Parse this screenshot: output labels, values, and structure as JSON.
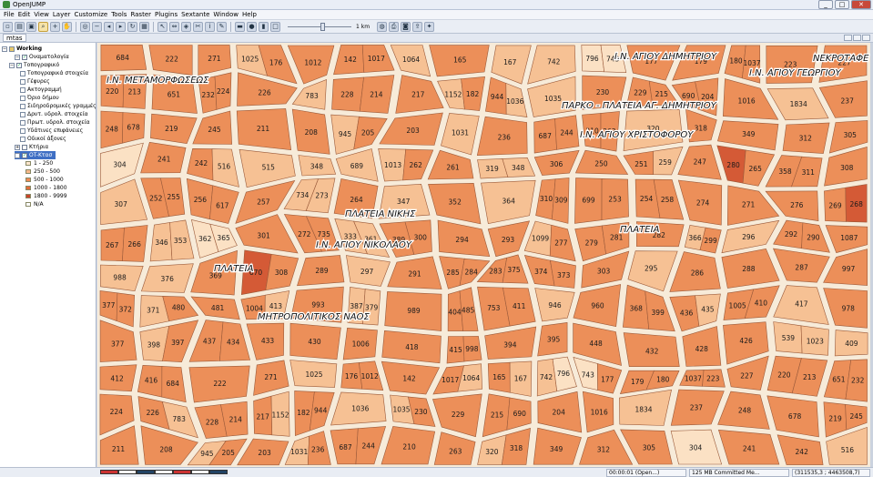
{
  "window": {
    "title": "OpenJUMP",
    "minimize": "_",
    "maximize": "□",
    "close": "✕"
  },
  "menu": [
    "File",
    "Edit",
    "View",
    "Layer",
    "Customize",
    "Tools",
    "Raster",
    "Plugins",
    "Sextante",
    "Window",
    "Help"
  ],
  "toolbar": {
    "icons": [
      "new-project-icon",
      "open-icon",
      "save-icon",
      "zoom-to-selection-icon",
      "zoom-in-icon",
      "pan-icon",
      "zoom-full-icon",
      "zoom-out-icon",
      "zoom-previous-icon",
      "zoom-next-icon",
      "refresh-icon",
      "grid-icon",
      "select-icon",
      "measure-icon",
      "layer-icon",
      "cut-icon",
      "info-icon",
      "edit-icon",
      "draw-icon",
      "color-icon",
      "fill-icon",
      "frame-icon",
      "globe-icon",
      "print-icon",
      "camera-icon",
      "export-icon",
      "compass-icon"
    ],
    "scale_label": "1 km"
  },
  "document": {
    "tab_label": "mtas"
  },
  "sidebar": {
    "category": "Working",
    "layers": [
      {
        "label": "Οναματολογία",
        "checked": true,
        "indent": 2
      },
      {
        "label": "Τοπογραφικό",
        "checked": true,
        "indent": 1
      },
      {
        "label": "Τοπογραφικά στοιχεία",
        "indent": 3
      },
      {
        "label": "Γέφυρες",
        "indent": 3
      },
      {
        "label": "Ακτογραμμή",
        "indent": 3
      },
      {
        "label": "Όριο δήμου",
        "indent": 3
      },
      {
        "label": "Σιδηροδρομικές γραμμές",
        "indent": 3
      },
      {
        "label": "Δρυτ. υδρολ. στοιχεία",
        "indent": 3
      },
      {
        "label": "Πρωτ. υδρολ. στοιχεία",
        "indent": 3
      },
      {
        "label": "Υδάτινες επιφάνειες",
        "indent": 3
      },
      {
        "label": "Οδικοί άξονες",
        "checked": true,
        "indent": 3
      },
      {
        "label": "Κτήρια",
        "indent": 2
      },
      {
        "label": "OT-Κτασ",
        "checked": true,
        "indent": 2,
        "selected": true
      }
    ],
    "legend": [
      {
        "label": "1 - 250",
        "color": "#fde6cd"
      },
      {
        "label": "250 - 500",
        "color": "#f7b98b"
      },
      {
        "label": "500 - 1000",
        "color": "#ee8a55"
      },
      {
        "label": "1000 - 1800",
        "color": "#e06c3b"
      },
      {
        "label": "1800 - 9999",
        "color": "#c9442a"
      },
      {
        "label": "N/A",
        "color": "#ffffff"
      }
    ]
  },
  "map": {
    "labels": [
      {
        "text": "Ι.Ν. ΜΕΤΑΜΟΡΦΩΣΕΩΣ"
      },
      {
        "text": "Ι.Ν. ΑΓΙΟΥ ΔΗΜΗΤΡΙΟΥ"
      },
      {
        "text": "Ι.Ν. ΑΓΙΟΥ ΓΕΩΡΓΙΟΥ"
      },
      {
        "text": "ΝΕΚΡΟΤΑΦΕ"
      },
      {
        "text": "ΠΑΡΚΟ - ΠΛΑΤΕΙΑ ΑΓ. ΔΗΜΗΤΡΙΟΥ"
      },
      {
        "text": "Ι.Ν. ΑΓΙΟΥ ΧΡΙΣΤΟΦΟΡΟΥ"
      },
      {
        "text": "ΠΛΑΤΕΙΑ ΝΙΚΗΣ"
      },
      {
        "text": "Ι.Ν. ΑΓΙΟΥ ΝΙΚΟΛΑΟΥ"
      },
      {
        "text": "ΠΛΑΤΕΙΑ"
      },
      {
        "text": "ΠΛΑΤΕΙΑ"
      },
      {
        "text": "ΜΗΤΡΟΠΟΛΙΤΙΚΟΣ ΝΑΟΣ"
      }
    ],
    "blocks": [
      {
        "id": "684",
        "t": 2
      },
      {
        "id": "222",
        "t": 2
      },
      {
        "id": "271",
        "t": 2
      },
      {
        "id": "1025",
        "t": 1
      },
      {
        "id": "176",
        "t": 2
      },
      {
        "id": "1012",
        "t": 2
      },
      {
        "id": "142",
        "t": 2
      },
      {
        "id": "1017",
        "t": 2
      },
      {
        "id": "1064",
        "t": 1
      },
      {
        "id": "165",
        "t": 2
      },
      {
        "id": "167",
        "t": 1
      },
      {
        "id": "742",
        "t": 1
      },
      {
        "id": "796",
        "t": 0
      },
      {
        "id": "743",
        "t": 0
      },
      {
        "id": "177",
        "t": 2
      },
      {
        "id": "179",
        "t": 2
      },
      {
        "id": "180",
        "t": 2
      },
      {
        "id": "1037",
        "t": 2
      },
      {
        "id": "223",
        "t": 2
      },
      {
        "id": "227",
        "t": 2
      },
      {
        "id": "220",
        "t": 2
      },
      {
        "id": "213",
        "t": 2
      },
      {
        "id": "651",
        "t": 2
      },
      {
        "id": "232",
        "t": 2
      },
      {
        "id": "224",
        "t": 2
      },
      {
        "id": "226",
        "t": 2
      },
      {
        "id": "783",
        "t": 1
      },
      {
        "id": "228",
        "t": 2
      },
      {
        "id": "214",
        "t": 2
      },
      {
        "id": "217",
        "t": 2
      },
      {
        "id": "1152",
        "t": 1
      },
      {
        "id": "182",
        "t": 2
      },
      {
        "id": "944",
        "t": 2
      },
      {
        "id": "1036",
        "t": 1
      },
      {
        "id": "1035",
        "t": 1
      },
      {
        "id": "230",
        "t": 2
      },
      {
        "id": "229",
        "t": 2
      },
      {
        "id": "215",
        "t": 2
      },
      {
        "id": "690",
        "t": 2
      },
      {
        "id": "204",
        "t": 2
      },
      {
        "id": "1016",
        "t": 2
      },
      {
        "id": "1834",
        "t": 1
      },
      {
        "id": "237",
        "t": 2
      },
      {
        "id": "248",
        "t": 2
      },
      {
        "id": "678",
        "t": 2
      },
      {
        "id": "219",
        "t": 2
      },
      {
        "id": "245",
        "t": 2
      },
      {
        "id": "211",
        "t": 2
      },
      {
        "id": "208",
        "t": 2
      },
      {
        "id": "945",
        "t": 1
      },
      {
        "id": "205",
        "t": 2
      },
      {
        "id": "203",
        "t": 2
      },
      {
        "id": "1031",
        "t": 1
      },
      {
        "id": "236",
        "t": 2
      },
      {
        "id": "687",
        "t": 2
      },
      {
        "id": "244",
        "t": 2
      },
      {
        "id": "210",
        "t": 2
      },
      {
        "id": "263",
        "t": 2
      },
      {
        "id": "320",
        "t": 1
      },
      {
        "id": "318",
        "t": 2
      },
      {
        "id": "349",
        "t": 2
      },
      {
        "id": "312",
        "t": 2
      },
      {
        "id": "305",
        "t": 2
      },
      {
        "id": "304",
        "t": 0
      },
      {
        "id": "241",
        "t": 2
      },
      {
        "id": "242",
        "t": 2
      },
      {
        "id": "516",
        "t": 1
      },
      {
        "id": "515",
        "t": 1
      },
      {
        "id": "348",
        "t": 1
      },
      {
        "id": "689",
        "t": 1
      },
      {
        "id": "1013",
        "t": 1
      },
      {
        "id": "262",
        "t": 2
      },
      {
        "id": "261",
        "t": 2
      },
      {
        "id": "319",
        "t": 1
      },
      {
        "id": "348",
        "t": 1
      },
      {
        "id": "306",
        "t": 2
      },
      {
        "id": "250",
        "t": 2
      },
      {
        "id": "251",
        "t": 2
      },
      {
        "id": "259",
        "t": 1
      },
      {
        "id": "247",
        "t": 2
      },
      {
        "id": "280",
        "t": 3
      },
      {
        "id": "265",
        "t": 2
      },
      {
        "id": "358",
        "t": 2
      },
      {
        "id": "311",
        "t": 2
      },
      {
        "id": "308",
        "t": 2
      },
      {
        "id": "307",
        "t": 1
      },
      {
        "id": "252",
        "t": 2
      },
      {
        "id": "255",
        "t": 2
      },
      {
        "id": "256",
        "t": 2
      },
      {
        "id": "617",
        "t": 2
      },
      {
        "id": "257",
        "t": 2
      },
      {
        "id": "734",
        "t": 1
      },
      {
        "id": "273",
        "t": 1
      },
      {
        "id": "264",
        "t": 2
      },
      {
        "id": "347",
        "t": 1
      },
      {
        "id": "352",
        "t": 2
      },
      {
        "id": "364",
        "t": 1
      },
      {
        "id": "310",
        "t": 2
      },
      {
        "id": "309",
        "t": 2
      },
      {
        "id": "699",
        "t": 2
      },
      {
        "id": "253",
        "t": 2
      },
      {
        "id": "254",
        "t": 2
      },
      {
        "id": "258",
        "t": 2
      },
      {
        "id": "274",
        "t": 2
      },
      {
        "id": "271",
        "t": 2
      },
      {
        "id": "276",
        "t": 2
      },
      {
        "id": "269",
        "t": 2
      },
      {
        "id": "268",
        "t": 3
      },
      {
        "id": "267",
        "t": 2
      },
      {
        "id": "266",
        "t": 2
      },
      {
        "id": "346",
        "t": 1
      },
      {
        "id": "353",
        "t": 1
      },
      {
        "id": "362",
        "t": 0
      },
      {
        "id": "365",
        "t": 0
      },
      {
        "id": "301",
        "t": 2
      },
      {
        "id": "272",
        "t": 2
      },
      {
        "id": "735",
        "t": 2
      },
      {
        "id": "333",
        "t": 1
      },
      {
        "id": "361",
        "t": 1
      },
      {
        "id": "389",
        "t": 2
      },
      {
        "id": "300",
        "t": 2
      },
      {
        "id": "294",
        "t": 2
      },
      {
        "id": "293",
        "t": 2
      },
      {
        "id": "1099",
        "t": 1
      },
      {
        "id": "277",
        "t": 2
      },
      {
        "id": "279",
        "t": 2
      },
      {
        "id": "281",
        "t": 2
      },
      {
        "id": "282",
        "t": 2
      },
      {
        "id": "366",
        "t": 1
      },
      {
        "id": "299",
        "t": 2
      },
      {
        "id": "296",
        "t": 1
      },
      {
        "id": "292",
        "t": 2
      },
      {
        "id": "290",
        "t": 2
      },
      {
        "id": "1087",
        "t": 2
      },
      {
        "id": "988",
        "t": 1
      },
      {
        "id": "376",
        "t": 1
      },
      {
        "id": "369",
        "t": 2
      },
      {
        "id": "670",
        "t": 3
      },
      {
        "id": "308",
        "t": 2
      },
      {
        "id": "289",
        "t": 2
      },
      {
        "id": "297",
        "t": 1
      },
      {
        "id": "291",
        "t": 2
      },
      {
        "id": "285",
        "t": 2
      },
      {
        "id": "284",
        "t": 2
      },
      {
        "id": "283",
        "t": 2
      },
      {
        "id": "375",
        "t": 2
      },
      {
        "id": "374",
        "t": 2
      },
      {
        "id": "373",
        "t": 2
      },
      {
        "id": "303",
        "t": 2
      },
      {
        "id": "295",
        "t": 1
      },
      {
        "id": "286",
        "t": 2
      },
      {
        "id": "288",
        "t": 2
      },
      {
        "id": "287",
        "t": 2
      },
      {
        "id": "997",
        "t": 2
      },
      {
        "id": "377",
        "t": 2
      },
      {
        "id": "372",
        "t": 2
      },
      {
        "id": "371",
        "t": 1
      },
      {
        "id": "480",
        "t": 2
      },
      {
        "id": "481",
        "t": 2
      },
      {
        "id": "1004",
        "t": 2
      },
      {
        "id": "413",
        "t": 1
      },
      {
        "id": "993",
        "t": 2
      },
      {
        "id": "387",
        "t": 1
      },
      {
        "id": "379",
        "t": 1
      },
      {
        "id": "989",
        "t": 2
      },
      {
        "id": "404",
        "t": 2
      },
      {
        "id": "485",
        "t": 2
      },
      {
        "id": "753",
        "t": 2
      },
      {
        "id": "411",
        "t": 2
      },
      {
        "id": "946",
        "t": 1
      },
      {
        "id": "960",
        "t": 2
      },
      {
        "id": "368",
        "t": 2
      },
      {
        "id": "399",
        "t": 2
      },
      {
        "id": "436",
        "t": 2
      },
      {
        "id": "435",
        "t": 1
      },
      {
        "id": "1005",
        "t": 2
      },
      {
        "id": "410",
        "t": 2
      },
      {
        "id": "417",
        "t": 1
      },
      {
        "id": "978",
        "t": 2
      },
      {
        "id": "377",
        "t": 2
      },
      {
        "id": "398",
        "t": 1
      },
      {
        "id": "397",
        "t": 2
      },
      {
        "id": "437",
        "t": 2
      },
      {
        "id": "434",
        "t": 2
      },
      {
        "id": "433",
        "t": 2
      },
      {
        "id": "430",
        "t": 2
      },
      {
        "id": "1006",
        "t": 2
      },
      {
        "id": "418",
        "t": 2
      },
      {
        "id": "415",
        "t": 2
      },
      {
        "id": "998",
        "t": 2
      },
      {
        "id": "394",
        "t": 2
      },
      {
        "id": "395",
        "t": 2
      },
      {
        "id": "448",
        "t": 2
      },
      {
        "id": "432",
        "t": 2
      },
      {
        "id": "428",
        "t": 2
      },
      {
        "id": "426",
        "t": 2
      },
      {
        "id": "539",
        "t": 1
      },
      {
        "id": "1023",
        "t": 1
      },
      {
        "id": "409",
        "t": 1
      },
      {
        "id": "412",
        "t": 2
      },
      {
        "id": "416",
        "t": 2
      }
    ]
  },
  "status": {
    "time": "00:00:01 (Open...)",
    "memory": "125 MB Committed Me...",
    "coords": "(311535,3 ; 4463508,7)"
  },
  "colors": {
    "t0": "#fbe1c4",
    "t1": "#f6c194",
    "t2": "#ec8f59",
    "t3": "#d45a36",
    "road": "#ffffff",
    "bg": "#f7ebd9"
  }
}
